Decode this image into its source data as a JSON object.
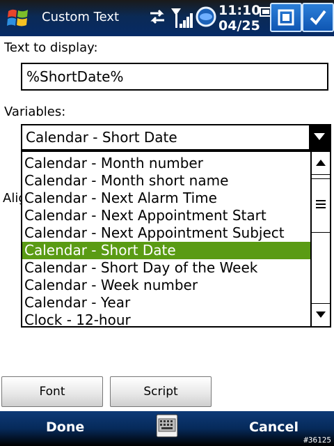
{
  "title_bar": {
    "app_title": "Custom Text",
    "time": "11:10",
    "date": "04/25"
  },
  "form": {
    "text_label": "Text to display:",
    "text_value": "%ShortDate%",
    "variables_label": "Variables:",
    "selected_variable": "Calendar - Short Date",
    "hidden_label_fragment": "Alig"
  },
  "dropdown": {
    "items": [
      "Calendar - Month number",
      "Calendar - Month short name",
      "Calendar - Next Alarm Time",
      "Calendar - Next Appointment Start",
      "Calendar - Next Appointment Subject",
      "Calendar - Short Date",
      "Calendar - Short Day of the Week",
      "Calendar - Week number",
      "Calendar - Year",
      "Clock - 12-hour"
    ],
    "selected_index": 5,
    "selection_color": "#5a9b14"
  },
  "buttons": {
    "font": "Font",
    "script": "Script"
  },
  "menu_bar": {
    "left": "Done",
    "right": "Cancel"
  },
  "watermark": "#36125",
  "icons": [
    "windows-start-icon",
    "sync-icon",
    "signal-icon",
    "globe-icon",
    "minimize-icon",
    "ok-check-icon",
    "keyboard-icon",
    "chevron-down-icon",
    "scroll-up-icon",
    "scroll-down-icon"
  ]
}
